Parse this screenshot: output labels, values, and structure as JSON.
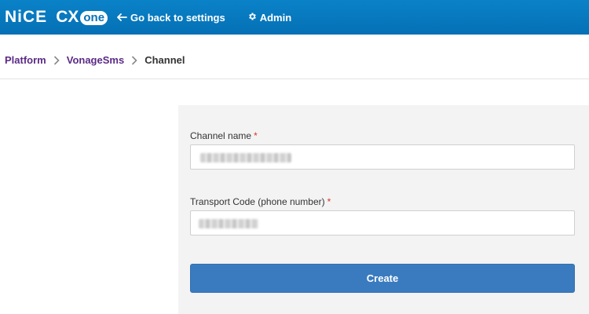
{
  "header": {
    "logo_nice": "NiCE",
    "logo_cx": "CX",
    "logo_one": "one",
    "back_icon": "arrow-left-icon",
    "back_label": "Go back to settings",
    "admin_icon": "gear-icon",
    "admin_label": "Admin",
    "bar_color": "#0873b8"
  },
  "breadcrumb": {
    "items": [
      {
        "label": "Platform"
      },
      {
        "label": "VonageSms"
      },
      {
        "label": "Channel"
      }
    ],
    "separator_icon": "chevron-right-icon",
    "link_color": "#5b2a86"
  },
  "form": {
    "channel_name_label": "Channel name",
    "channel_name_required": "*",
    "transport_code_label": "Transport Code (phone number)",
    "transport_code_required": "*",
    "submit_label": "Create",
    "button_color": "#3a7bbf"
  }
}
